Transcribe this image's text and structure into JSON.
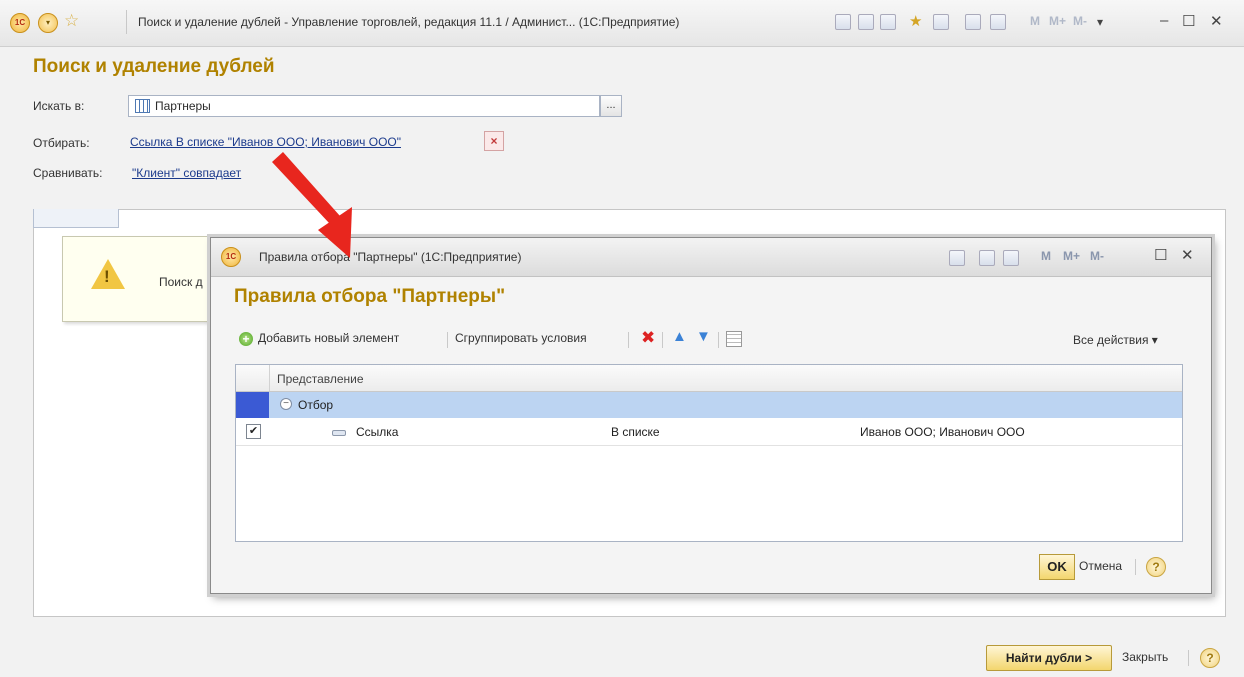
{
  "main_window": {
    "title": "Поиск и удаление дублей - Управление торговлей, редакция 11.1 / Админист...  (1С:Предприятие)",
    "logo_text": "1С",
    "heading": "Поиск и удаление дублей",
    "search_in_label": "Искать в:",
    "search_in_value": "Партнеры",
    "search_in_button": "...",
    "filter_label": "Отбирать:",
    "filter_value": "Ссылка В списке \"Иванов ООО; Иванович ООО\"",
    "compare_label": "Сравнивать:",
    "compare_value": "\"Клиент\" совпадает",
    "message_text": "Поиск д",
    "toolbar_letters": [
      "M",
      "M+",
      "M-"
    ],
    "find_button": "Найти дубли >",
    "close_button": "Закрыть",
    "help": "?"
  },
  "dialog": {
    "title": "Правила отбора \"Партнеры\"  (1С:Предприятие)",
    "logo_text": "1С",
    "heading": "Правила отбора \"Партнеры\"",
    "title_letters": [
      "M",
      "M+",
      "M-"
    ],
    "toolbar": {
      "add": "Добавить новый элемент",
      "group": "Сгруппировать условия",
      "all_actions": "Все действия ▾"
    },
    "table": {
      "column": "Представление",
      "group_row": "Отбор",
      "item_row": {
        "field": "Ссылка",
        "condition": "В списке",
        "value": "Иванов ООО; Иванович ООО",
        "checked": "✔"
      }
    },
    "ok": "OK",
    "cancel": "Отмена",
    "help": "?"
  },
  "colors": {
    "heading": "#b08200",
    "link": "#1b3a8c",
    "selection": "#bcd4f2",
    "arrow": "#e8261e"
  }
}
